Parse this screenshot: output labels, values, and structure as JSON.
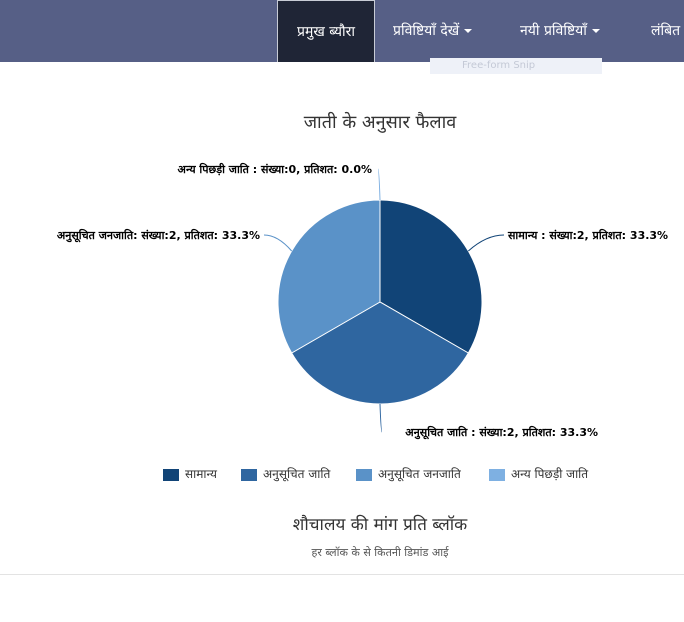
{
  "nav": {
    "items": [
      {
        "label": "प्रमुख ब्यौरा",
        "active": true
      },
      {
        "label": "प्रविष्टियाँ देखें",
        "dropdown": true
      },
      {
        "label": "नयी प्रविष्टियाँ",
        "dropdown": true
      },
      {
        "label": "लंबित"
      }
    ],
    "overlay_text": "Free-form Snip"
  },
  "chart_data": {
    "type": "pie",
    "title": "जाती के अनुसार फैलाव",
    "slices": [
      {
        "name": "सामान्य",
        "count": 2,
        "percent": 33.3,
        "label": "सामान्य : संख्या:2, प्रतिशत: 33.3%",
        "color": "#114477"
      },
      {
        "name": "अनुसूचित जाति",
        "count": 2,
        "percent": 33.3,
        "label": "अनुसूचित जाति : संख्या:2, प्रतिशत: 33.3%",
        "color": "#2f66a0"
      },
      {
        "name": "अनुसूचित जनजाति",
        "count": 2,
        "percent": 33.3,
        "label": "अनुसूचित जनजाति: संख्या:2, प्रतिशत: 33.3%",
        "color": "#5a92c8"
      },
      {
        "name": "अन्य पिछड़ी जाति",
        "count": 0,
        "percent": 0.0,
        "label": "अन्य पिछड़ी जाति : संख्या:0, प्रतिशत: 0.0%",
        "color": "#7eb0e2"
      }
    ],
    "legend_position": "bottom"
  },
  "section": {
    "title": "शौचालय की मांग प्रति ब्लॉक",
    "subtitle": "हर ब्लॉक के से कितनी डिमांड आई"
  }
}
